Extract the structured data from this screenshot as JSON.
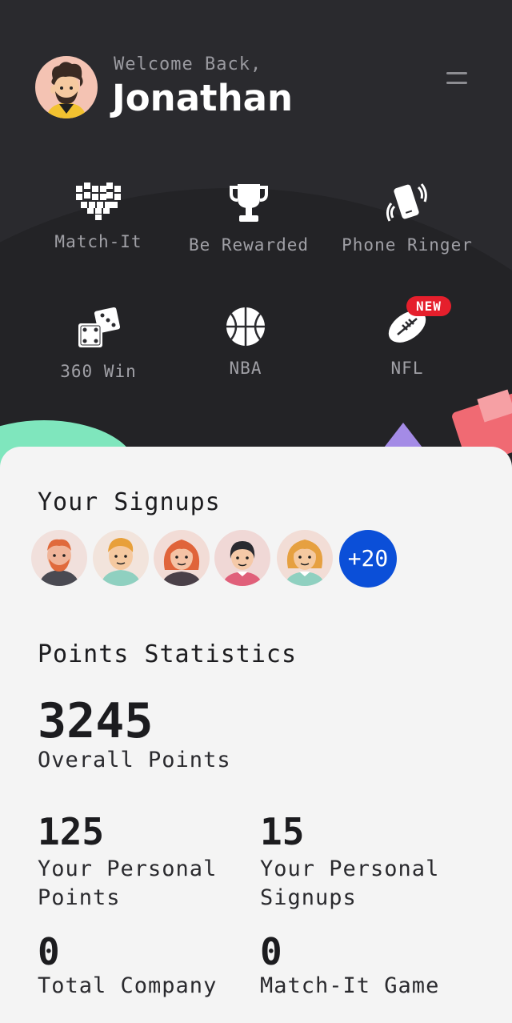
{
  "header": {
    "welcome": "Welcome Back,",
    "name": "Jonathan"
  },
  "tiles": [
    {
      "label": "Match-It",
      "icon": "pixel-heart-icon"
    },
    {
      "label": "Be Rewarded",
      "icon": "trophy-icon"
    },
    {
      "label": "Phone Ringer",
      "icon": "phone-ring-icon"
    },
    {
      "label": "360 Win",
      "icon": "dice-icon"
    },
    {
      "label": "NBA",
      "icon": "basketball-icon"
    },
    {
      "label": "NFL",
      "icon": "football-icon",
      "badge": "NEW"
    }
  ],
  "signups": {
    "title": "Your Signups",
    "more": "+20"
  },
  "stats": {
    "title": "Points Statistics",
    "overall_value": "3245",
    "overall_label": "Overall Points",
    "items": [
      {
        "value": "125",
        "label": "Your Personal Points"
      },
      {
        "value": "15",
        "label": "Your Personal Signups"
      },
      {
        "value": "0",
        "label": "Total Company"
      },
      {
        "value": "0",
        "label": "Match-It Game"
      }
    ]
  },
  "colors": {
    "background": "#2a2a2e",
    "card": "#f4f4f4",
    "accent_blue": "#0b4fd8",
    "badge_red": "#e51f2c"
  }
}
